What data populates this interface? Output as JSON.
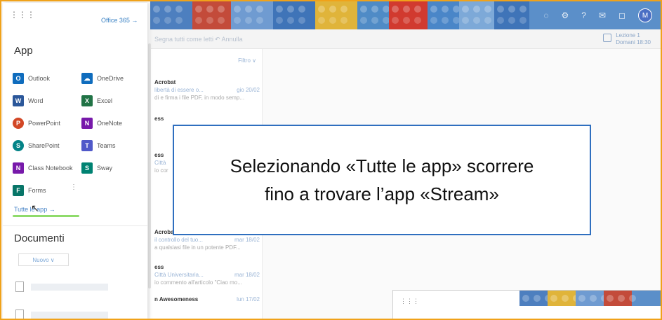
{
  "launcher": {
    "office_link": "Office 365 →",
    "apps_title": "App",
    "apps": [
      {
        "label": "Outlook",
        "icon": "outlook-icon",
        "color": "#0f6cbd",
        "glyph": "O"
      },
      {
        "label": "OneDrive",
        "icon": "onedrive-icon",
        "color": "#0f6cbd",
        "glyph": "☁"
      },
      {
        "label": "Word",
        "icon": "word-icon",
        "color": "#2b579a",
        "glyph": "W"
      },
      {
        "label": "Excel",
        "icon": "excel-icon",
        "color": "#217346",
        "glyph": "X"
      },
      {
        "label": "PowerPoint",
        "icon": "powerpoint-icon",
        "color": "#d24726",
        "glyph": "P"
      },
      {
        "label": "OneNote",
        "icon": "onenote-icon",
        "color": "#7719aa",
        "glyph": "N"
      },
      {
        "label": "SharePoint",
        "icon": "sharepoint-icon",
        "color": "#038387",
        "glyph": "S"
      },
      {
        "label": "Teams",
        "icon": "teams-icon",
        "color": "#5059c9",
        "glyph": "T"
      },
      {
        "label": "Class Notebook",
        "icon": "class-notebook-icon",
        "color": "#7719aa",
        "glyph": "N"
      },
      {
        "label": "Sway",
        "icon": "sway-icon",
        "color": "#008272",
        "glyph": "S"
      },
      {
        "label": "Forms",
        "icon": "forms-icon",
        "color": "#077568",
        "glyph": "F"
      }
    ],
    "all_apps": "Tutte le app →",
    "docs_title": "Documenti",
    "new_button": "Nuovo ∨"
  },
  "toolbar": {
    "mark_read": "Segna tutti come letti",
    "undo": "↶ Annulla",
    "calendar_title": "Lezione 1",
    "calendar_time": "Domani 18:30"
  },
  "mail_list": {
    "filter": "Filtro ∨",
    "items": [
      {
        "sender": "Acrobat",
        "subject": "libertà di essere o...",
        "date": "gio 20/02",
        "preview": "di e firma i file PDF, in modo semp..."
      },
      {
        "sender": "ess",
        "subject": "",
        "date": "",
        "preview": ""
      },
      {
        "sender": "ess",
        "subject": "Città",
        "date": "",
        "preview": "io cor"
      },
      {
        "sender": "Acrobat",
        "subject": "il controllo del tuo...",
        "date": "mar 18/02",
        "preview": "a qualsiasi file in un potente PDF..."
      },
      {
        "sender": "ess",
        "subject": "Città Universitaria...",
        "date": "mar 18/02",
        "preview": "io commento all'articolo \"Ciao mo..."
      },
      {
        "sender": "n Awesomeness",
        "subject": "",
        "date": "lun 17/02",
        "preview": ""
      }
    ]
  },
  "callout": {
    "line1": "Selezionando «Tutte le app» scorrere",
    "line2": "fino a trovare l’app «Stream»"
  },
  "header": {
    "avatar_initials": "M"
  }
}
